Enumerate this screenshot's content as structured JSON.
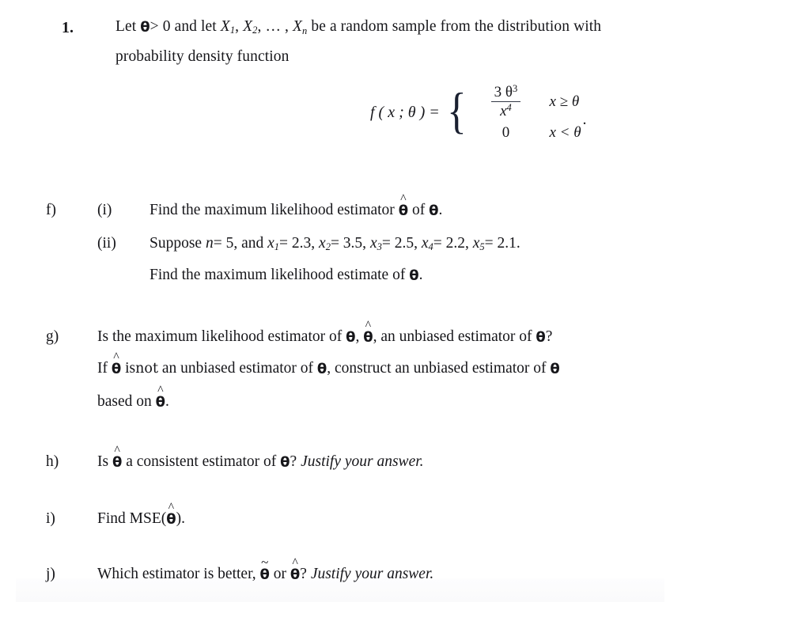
{
  "document": {
    "type": "statistics-problem-set",
    "question_number": "1.",
    "stem": {
      "line1_pre": "Let",
      "theta": "θ",
      "inequality": "> 0",
      "line1_mid": "and  let",
      "vars": [
        "X",
        "X",
        "X"
      ],
      "var_subs": [
        "1",
        "2",
        "n"
      ],
      "ellipsis": ", … ,",
      "line1_post": "be a random sample from the distribution with",
      "line2": "probability density function"
    },
    "formula": {
      "lhs": "f ( x ;  θ ) =",
      "case1_numerator": "3 θ",
      "case1_numerator_exp": "3",
      "case1_denominator": "x",
      "case1_denominator_exp": "4",
      "case1_condition": "x ≥ θ",
      "case2_value": "0",
      "case2_condition": "x < θ",
      "trailing_period": "."
    },
    "parts": [
      {
        "letter": "f)",
        "items": [
          {
            "roman": "(i)",
            "text_pre": "Find the maximum likelihood estimator",
            "symbol_hat": "θ",
            "text_post": "of",
            "symbol_plain": "θ",
            "period": "."
          },
          {
            "roman": "(ii)",
            "line1": {
              "suppose": "Suppose",
              "n_label": "n",
              "n_value": "= 5,",
              "and": "and",
              "samples": [
                {
                  "name": "x",
                  "sub": "1",
                  "value": "= 2.3,"
                },
                {
                  "name": "x",
                  "sub": "2",
                  "value": "= 3.5,"
                },
                {
                  "name": "x",
                  "sub": "3",
                  "value": "= 2.5,"
                },
                {
                  "name": "x",
                  "sub": "4",
                  "value": "= 2.2,"
                },
                {
                  "name": "x",
                  "sub": "5",
                  "value": "= 2.1."
                }
              ]
            },
            "line2_pre": "Find the maximum likelihood estimate of",
            "line2_symbol": "θ",
            "line2_period": "."
          }
        ]
      },
      {
        "letter": "g)",
        "line1_a": "Is the maximum likelihood estimator of",
        "line1_theta": "θ",
        "line1_comma": ",",
        "line1_theta_hat": "θ",
        "line1_b": ", an unbiased estimator of",
        "line1_theta2": "θ",
        "line1_q": "?",
        "line2_a": "If",
        "line2_theta_hat": "θ",
        "line2_is": "is",
        "line2_not": "not",
        "line2_b": "an unbiased estimator of",
        "line2_theta": "θ",
        "line2_c": ",  construct an unbiased estimator of",
        "line2_theta2": "θ",
        "line3_a": "based on",
        "line3_theta_hat": "θ",
        "line3_period": "."
      },
      {
        "letter": "h)",
        "text_a": "Is",
        "theta_hat": "θ",
        "text_b": "a consistent estimator of",
        "theta": "θ",
        "question": "?",
        "italic_tail": "Justify your answer."
      },
      {
        "letter": "i)",
        "text_a": "Find",
        "mse": "MSE",
        "paren_open": "(",
        "theta_hat": "θ",
        "paren_close": ")",
        "period": "."
      },
      {
        "letter": "j)",
        "text_a": "Which estimator is better,",
        "theta_tilde": "θ",
        "or": "or",
        "theta_hat": "θ",
        "question": "?",
        "italic_tail": "Justify your answer."
      }
    ],
    "accents": {
      "hat": "^",
      "tilde": "~"
    }
  }
}
